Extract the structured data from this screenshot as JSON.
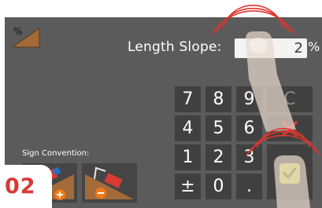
{
  "field": {
    "label": "Length Slope:",
    "value": "2",
    "unit": "%"
  },
  "keypad": {
    "k7": "7",
    "k8": "8",
    "k9": "9",
    "clear": "C",
    "k4": "4",
    "k5": "5",
    "k6": "6",
    "k1": "1",
    "k2": "2",
    "k3": "3",
    "plusminus": "±",
    "k0": "0",
    "dot": "."
  },
  "sign": {
    "label": "Sign Convention:"
  },
  "step_badge": "02",
  "colors": {
    "panel": "#5b5b5b",
    "key": "#404040",
    "accent": "#d83a34",
    "confirm": "#c8d84a"
  },
  "icons": [
    "slope-percent-icon",
    "cancel-x-icon",
    "confirm-check-icon",
    "excavator-uphill-icon",
    "excavator-downhill-icon"
  ]
}
